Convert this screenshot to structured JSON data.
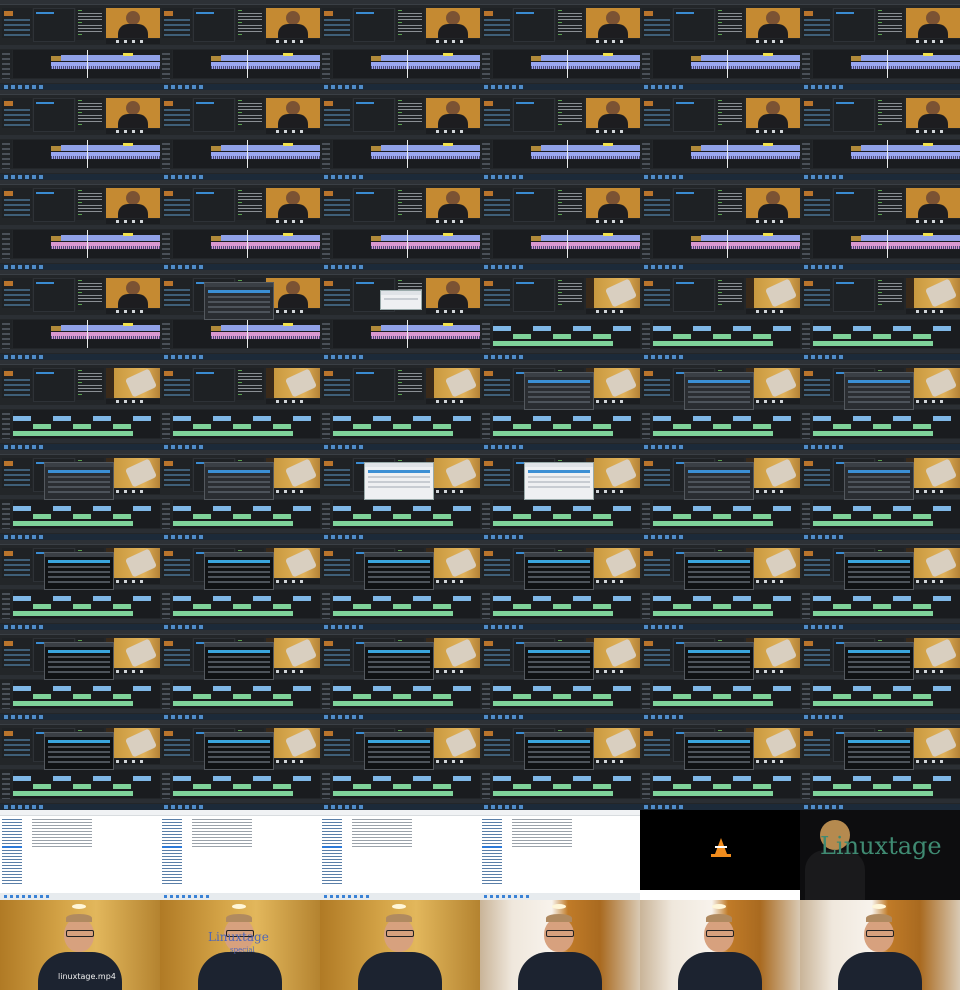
{
  "sheet": {
    "columns": 6,
    "rows": 11
  },
  "frames": [
    "editor-speaker",
    "editor-speaker",
    "editor-speaker",
    "editor-speaker",
    "editor-speaker",
    "editor-speaker",
    "editor-speaker",
    "editor-speaker",
    "editor-speaker",
    "editor-speaker",
    "editor-speaker",
    "editor-speaker",
    "editor-speaker-pink",
    "editor-speaker-pink",
    "editor-speaker-pink",
    "editor-speaker-pink",
    "editor-speaker-pink",
    "editor-speaker-pink",
    "editor-speaker-pink",
    "editor-dialog",
    "editor-popup",
    "editor-hands",
    "editor-hands",
    "editor-hands",
    "editor-hands",
    "editor-hands",
    "editor-hands",
    "editor-hands-dialog",
    "editor-hands-dialog",
    "editor-hands-dialog",
    "editor-hands-dialog",
    "editor-hands-dialog",
    "editor-hands-light",
    "editor-hands-light",
    "editor-hands-dialog",
    "editor-hands-dialog",
    "editor-render",
    "editor-render",
    "editor-render",
    "editor-render",
    "editor-render",
    "editor-render",
    "editor-render",
    "editor-render",
    "editor-render",
    "editor-render",
    "editor-render",
    "editor-render",
    "editor-render",
    "editor-render",
    "editor-render",
    "editor-render",
    "editor-render",
    "editor-render",
    "explorer",
    "explorer",
    "explorer",
    "explorer",
    "vlc",
    "dark-logo",
    "cam-caption",
    "cam-logo",
    "cam-plain",
    "cam-room",
    "cam-room",
    "cam-room"
  ],
  "overlay_text": {
    "caption": "linuxtage.mp4",
    "logo_large": "Linuxtage",
    "logo_small": "Linuxtage",
    "logo_sub": "special"
  }
}
